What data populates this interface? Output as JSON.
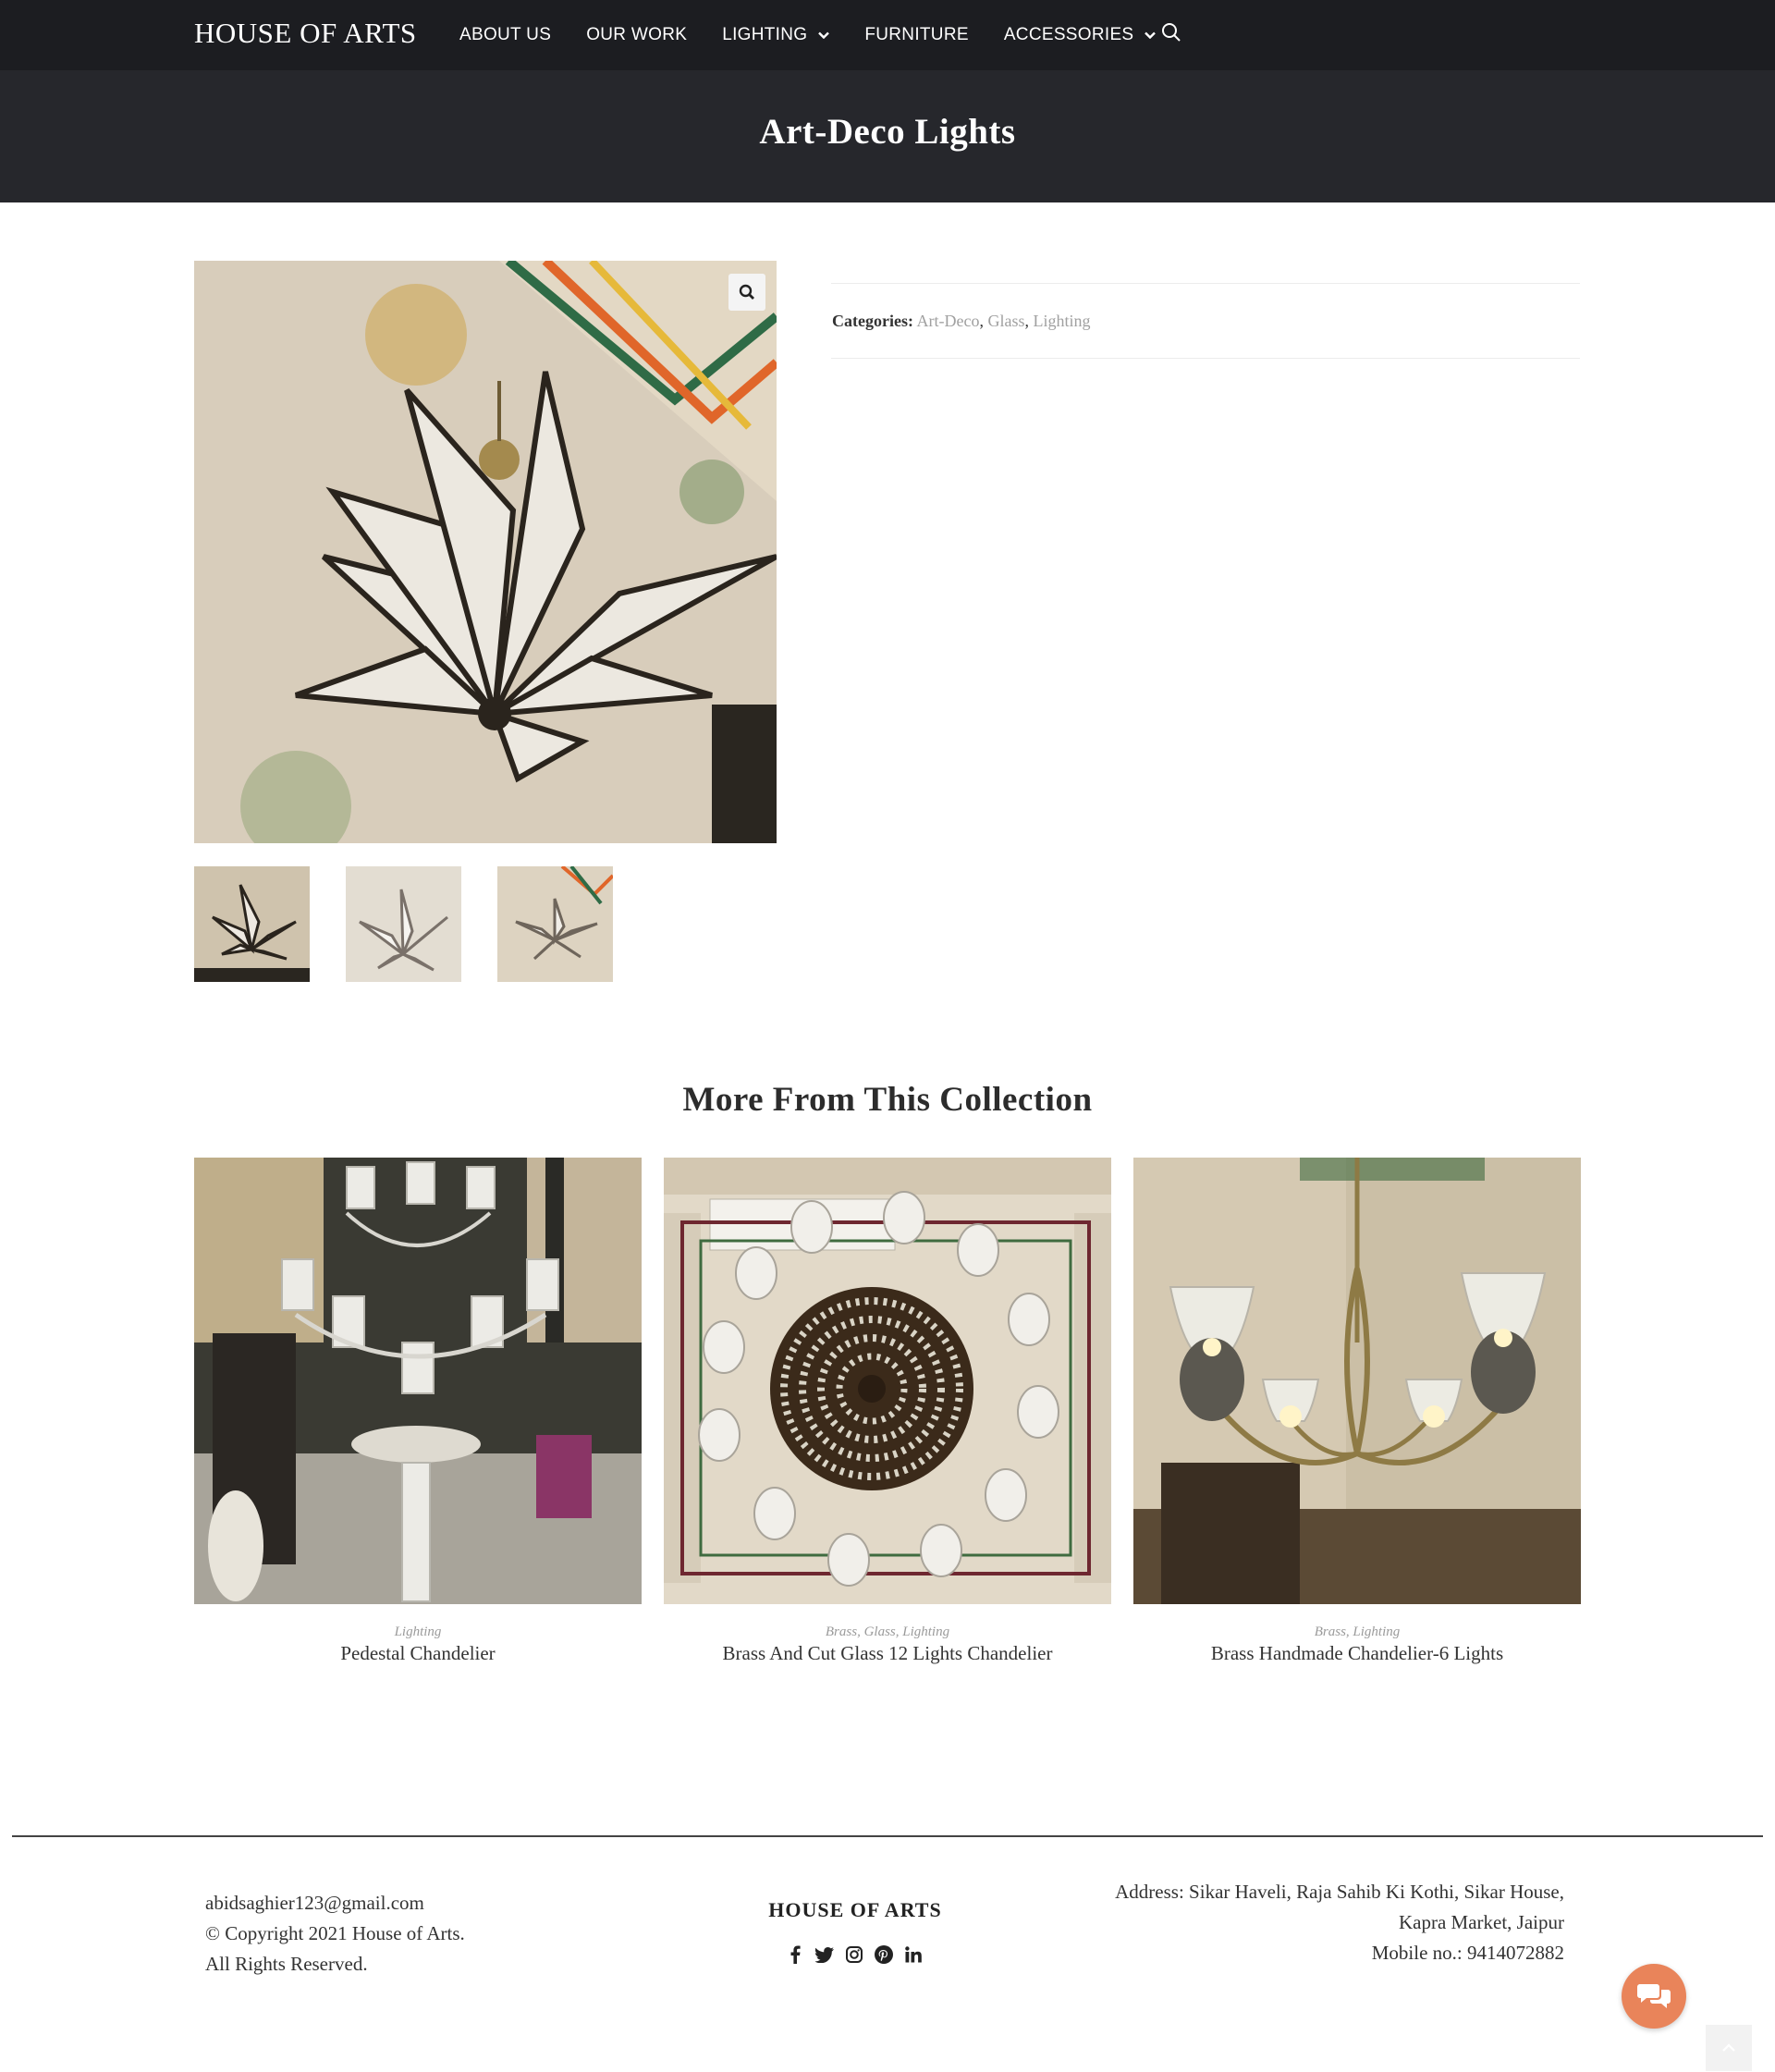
{
  "nav": {
    "logo": "HOUSE OF ARTS",
    "items": [
      {
        "label": "ABOUT US",
        "dropdown": false
      },
      {
        "label": "OUR WORK",
        "dropdown": false
      },
      {
        "label": "LIGHTING",
        "dropdown": true
      },
      {
        "label": "FURNITURE",
        "dropdown": false
      },
      {
        "label": "ACCESSORIES",
        "dropdown": true
      }
    ]
  },
  "page": {
    "title": "Art-Deco Lights"
  },
  "product": {
    "categories_label": "Categories:",
    "categories": [
      "Art-Deco",
      "Glass",
      "Lighting"
    ]
  },
  "related": {
    "title": "More From This Collection",
    "items": [
      {
        "category": "Lighting",
        "title": "Pedestal Chandelier"
      },
      {
        "category": "Brass, Glass, Lighting",
        "title": "Brass And Cut Glass 12 Lights Chandelier"
      },
      {
        "category": "Brass, Lighting",
        "title": "Brass Handmade Chandelier-6 Lights"
      }
    ]
  },
  "footer": {
    "email": "abidsaghier123@gmail.com",
    "copyright": "© Copyright 2021 House of Arts.",
    "rights": "All Rights Reserved.",
    "brand": "HOUSE OF ARTS",
    "address_line1": "Address: Sikar Haveli, Raja Sahib Ki Kothi, Sikar House,",
    "address_line2": "Kapra Market, Jaipur",
    "mobile": "Mobile no.: 9414072882",
    "socials": [
      "facebook-icon",
      "twitter-icon",
      "instagram-icon",
      "pinterest-icon",
      "linkedin-icon"
    ]
  },
  "colors": {
    "nav_bg": "#1c1d21",
    "title_band_bg": "#26272c",
    "chat_button": "#e9845a",
    "category_link": "#a0a0a0"
  }
}
